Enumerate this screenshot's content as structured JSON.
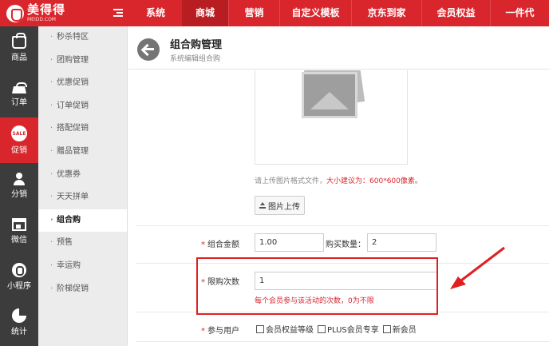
{
  "brand": {
    "name": "美得得",
    "sub": "MEIDD.COM"
  },
  "topnav": [
    "系统",
    "商城",
    "营销",
    "自定义模板",
    "京东到家",
    "会员权益",
    "一件代"
  ],
  "topnav_active": 1,
  "sidebar": [
    {
      "label": "商品",
      "icon": "bag-icon"
    },
    {
      "label": "订单",
      "icon": "basket-icon"
    },
    {
      "label": "促销",
      "icon": "sale-icon",
      "badge": "SALE"
    },
    {
      "label": "分销",
      "icon": "user-icon"
    },
    {
      "label": "微信",
      "icon": "shop-icon"
    },
    {
      "label": "小程序",
      "icon": "miniprogram-icon"
    },
    {
      "label": "统计",
      "icon": "pie-chart-icon"
    }
  ],
  "sidebar_active": 2,
  "subnav": [
    "秒杀特区",
    "团购管理",
    "优惠促销",
    "订单促销",
    "搭配促销",
    "赠品管理",
    "优惠券",
    "天天拼单",
    "组合购",
    "预售",
    "幸运购",
    "阶梯促销"
  ],
  "subnav_active": 8,
  "header": {
    "title": "组合购管理",
    "subtitle": "系统编辑组合购"
  },
  "upload": {
    "hint_prefix": "请上传图片格式文件，",
    "hint_red": "大小建议为：600*600像素。",
    "button_label": "图片上传"
  },
  "form": {
    "amount_label": "组合金额",
    "amount_value": "1.00",
    "qty_label": "购买数量：",
    "qty_value": "2",
    "limit_label": "限购次数",
    "limit_value": "1",
    "limit_note": "每个会员参与该活动的次数，0为不限",
    "users_label": "参与用户",
    "user_options": [
      "会员权益等级",
      "PLUS会员专享",
      "新会员"
    ]
  },
  "colors": {
    "brand_red": "#d9262c",
    "sidebar_dark": "#3c3c3c",
    "highlight": "#e02020"
  }
}
